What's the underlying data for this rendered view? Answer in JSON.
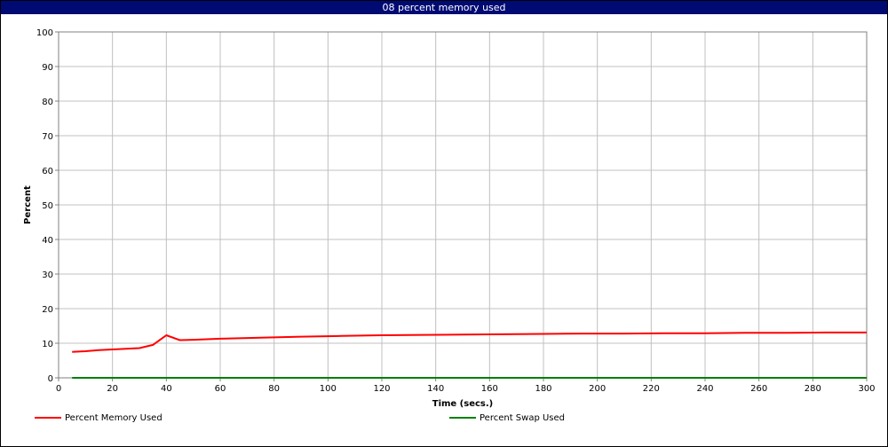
{
  "window": {
    "title": "08 percent memory used"
  },
  "chart_data": {
    "type": "line",
    "title": "08 percent memory used",
    "xlabel": "Time (secs.)",
    "ylabel": "Percent",
    "xlim": [
      0,
      300
    ],
    "ylim": [
      0,
      100
    ],
    "x_ticks": [
      0,
      20,
      40,
      60,
      80,
      100,
      120,
      140,
      160,
      180,
      200,
      220,
      240,
      260,
      280,
      300
    ],
    "y_ticks": [
      0,
      10,
      20,
      30,
      40,
      50,
      60,
      70,
      80,
      90,
      100
    ],
    "grid": true,
    "legend_position": "bottom",
    "series": [
      {
        "name": "Percent Memory Used",
        "color": "#ff0000",
        "x": [
          5,
          10,
          15,
          20,
          25,
          30,
          35,
          40,
          45,
          50,
          60,
          75,
          90,
          105,
          120,
          135,
          150,
          165,
          180,
          195,
          210,
          225,
          240,
          255,
          270,
          285,
          300
        ],
        "values": [
          7.5,
          7.7,
          8.0,
          8.2,
          8.4,
          8.6,
          9.5,
          12.3,
          10.9,
          11.0,
          11.3,
          11.6,
          11.9,
          12.1,
          12.3,
          12.4,
          12.5,
          12.6,
          12.7,
          12.8,
          12.8,
          12.9,
          12.9,
          13.0,
          13.0,
          13.1,
          13.1
        ]
      },
      {
        "name": "Percent Swap Used",
        "color": "#008000",
        "x": [
          5,
          300
        ],
        "values": [
          0,
          0
        ]
      }
    ]
  }
}
